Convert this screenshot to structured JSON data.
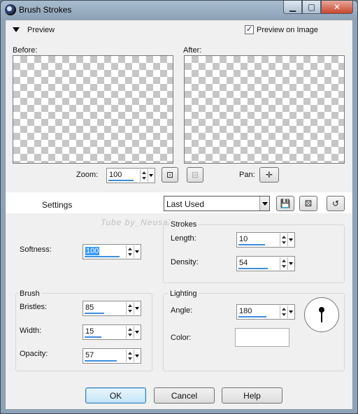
{
  "window": {
    "title": "Brush Strokes",
    "controls": {
      "minimize": "▁",
      "maximize": "▢",
      "close": "✕"
    }
  },
  "preview": {
    "header": "Preview",
    "preview_on_image_label": "Preview on Image",
    "preview_on_image_checked": true,
    "before_label": "Before:",
    "after_label": "After:",
    "zoom_label": "Zoom:",
    "zoom_value": "100",
    "pan_label": "Pan:",
    "icons": {
      "zoom_fit": "zoom-fit-icon",
      "zoom_actual": "zoom-actual-icon",
      "pan": "pan-move-icon"
    }
  },
  "settings": {
    "label": "Settings",
    "preset_value": "Last Used",
    "icons": {
      "save": "save-preset-icon",
      "randomize": "randomize-dice-icon",
      "reset": "reset-icon"
    }
  },
  "watermark": "Tube by_Neusalyaes",
  "softness": {
    "label": "Softness:",
    "value": "100"
  },
  "strokes": {
    "group_label": "Strokes",
    "length_label": "Length:",
    "length_value": "10",
    "density_label": "Density:",
    "density_value": "54"
  },
  "brush": {
    "group_label": "Brush",
    "bristles_label": "Bristles:",
    "bristles_value": "85",
    "width_label": "Width:",
    "width_value": "15",
    "opacity_label": "Opacity:",
    "opacity_value": "57"
  },
  "lighting": {
    "group_label": "Lighting",
    "angle_label": "Angle:",
    "angle_value": "180",
    "color_label": "Color:",
    "color_value": "#ffffff"
  },
  "buttons": {
    "ok": "OK",
    "cancel": "Cancel",
    "help": "Help"
  },
  "colors": {
    "accent": "#3c8de0",
    "selection": "#3399ff",
    "checker": "#c6c6c6"
  }
}
